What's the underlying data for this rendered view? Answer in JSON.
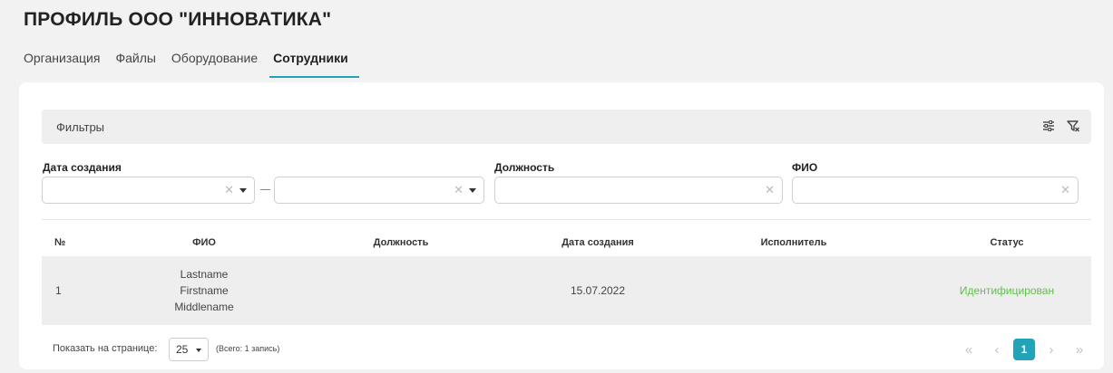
{
  "page": {
    "title": "ПРОФИЛЬ ООО \"ИННОВАТИКА\""
  },
  "tabs": [
    {
      "label": "Организация",
      "active": false
    },
    {
      "label": "Файлы",
      "active": false
    },
    {
      "label": "Оборудование",
      "active": false
    },
    {
      "label": "Сотрудники",
      "active": true
    }
  ],
  "filters": {
    "label": "Фильтры",
    "icons": [
      "sliders-icon",
      "filter-clear-icon"
    ],
    "date_label": "Дата создания",
    "date_from": {
      "value": "",
      "placeholder": ""
    },
    "date_to": {
      "value": "",
      "placeholder": ""
    },
    "position_label": "Должность",
    "position_input": {
      "value": "",
      "placeholder": ""
    },
    "fio_label": "ФИО",
    "fio_input": {
      "value": "",
      "placeholder": ""
    }
  },
  "table": {
    "columns": [
      "№",
      "ФИО",
      "Должность",
      "Дата создания",
      "Исполнитель",
      "Статус"
    ],
    "rows": [
      {
        "num": "1",
        "fio_lastname": "Lastname",
        "fio_firstname": "Firstname",
        "fio_middlename": "Middlename",
        "position": "",
        "created": "15.07.2022",
        "executor": "",
        "status": "Идентифицирован"
      }
    ]
  },
  "footer": {
    "per_page_label": "Показать на странице:",
    "per_page_value": "25",
    "total": "(Всего: 1 запись)",
    "pager": {
      "first": "«",
      "prev": "‹",
      "current": "1",
      "next": "›",
      "last": "»"
    }
  },
  "colors": {
    "accent": "#23a3b7",
    "status_ok": "#5cc246"
  }
}
